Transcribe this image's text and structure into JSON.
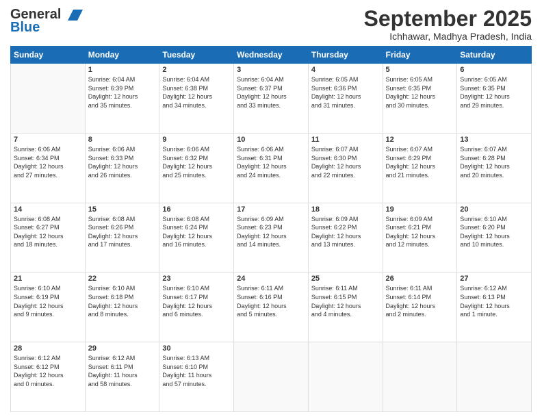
{
  "logo": {
    "line1": "General",
    "line2": "Blue"
  },
  "title": "September 2025",
  "subtitle": "Ichhawar, Madhya Pradesh, India",
  "days_of_week": [
    "Sunday",
    "Monday",
    "Tuesday",
    "Wednesday",
    "Thursday",
    "Friday",
    "Saturday"
  ],
  "weeks": [
    [
      {
        "day": "",
        "info": ""
      },
      {
        "day": "1",
        "info": "Sunrise: 6:04 AM\nSunset: 6:39 PM\nDaylight: 12 hours\nand 35 minutes."
      },
      {
        "day": "2",
        "info": "Sunrise: 6:04 AM\nSunset: 6:38 PM\nDaylight: 12 hours\nand 34 minutes."
      },
      {
        "day": "3",
        "info": "Sunrise: 6:04 AM\nSunset: 6:37 PM\nDaylight: 12 hours\nand 33 minutes."
      },
      {
        "day": "4",
        "info": "Sunrise: 6:05 AM\nSunset: 6:36 PM\nDaylight: 12 hours\nand 31 minutes."
      },
      {
        "day": "5",
        "info": "Sunrise: 6:05 AM\nSunset: 6:35 PM\nDaylight: 12 hours\nand 30 minutes."
      },
      {
        "day": "6",
        "info": "Sunrise: 6:05 AM\nSunset: 6:35 PM\nDaylight: 12 hours\nand 29 minutes."
      }
    ],
    [
      {
        "day": "7",
        "info": "Sunrise: 6:06 AM\nSunset: 6:34 PM\nDaylight: 12 hours\nand 27 minutes."
      },
      {
        "day": "8",
        "info": "Sunrise: 6:06 AM\nSunset: 6:33 PM\nDaylight: 12 hours\nand 26 minutes."
      },
      {
        "day": "9",
        "info": "Sunrise: 6:06 AM\nSunset: 6:32 PM\nDaylight: 12 hours\nand 25 minutes."
      },
      {
        "day": "10",
        "info": "Sunrise: 6:06 AM\nSunset: 6:31 PM\nDaylight: 12 hours\nand 24 minutes."
      },
      {
        "day": "11",
        "info": "Sunrise: 6:07 AM\nSunset: 6:30 PM\nDaylight: 12 hours\nand 22 minutes."
      },
      {
        "day": "12",
        "info": "Sunrise: 6:07 AM\nSunset: 6:29 PM\nDaylight: 12 hours\nand 21 minutes."
      },
      {
        "day": "13",
        "info": "Sunrise: 6:07 AM\nSunset: 6:28 PM\nDaylight: 12 hours\nand 20 minutes."
      }
    ],
    [
      {
        "day": "14",
        "info": "Sunrise: 6:08 AM\nSunset: 6:27 PM\nDaylight: 12 hours\nand 18 minutes."
      },
      {
        "day": "15",
        "info": "Sunrise: 6:08 AM\nSunset: 6:26 PM\nDaylight: 12 hours\nand 17 minutes."
      },
      {
        "day": "16",
        "info": "Sunrise: 6:08 AM\nSunset: 6:24 PM\nDaylight: 12 hours\nand 16 minutes."
      },
      {
        "day": "17",
        "info": "Sunrise: 6:09 AM\nSunset: 6:23 PM\nDaylight: 12 hours\nand 14 minutes."
      },
      {
        "day": "18",
        "info": "Sunrise: 6:09 AM\nSunset: 6:22 PM\nDaylight: 12 hours\nand 13 minutes."
      },
      {
        "day": "19",
        "info": "Sunrise: 6:09 AM\nSunset: 6:21 PM\nDaylight: 12 hours\nand 12 minutes."
      },
      {
        "day": "20",
        "info": "Sunrise: 6:10 AM\nSunset: 6:20 PM\nDaylight: 12 hours\nand 10 minutes."
      }
    ],
    [
      {
        "day": "21",
        "info": "Sunrise: 6:10 AM\nSunset: 6:19 PM\nDaylight: 12 hours\nand 9 minutes."
      },
      {
        "day": "22",
        "info": "Sunrise: 6:10 AM\nSunset: 6:18 PM\nDaylight: 12 hours\nand 8 minutes."
      },
      {
        "day": "23",
        "info": "Sunrise: 6:10 AM\nSunset: 6:17 PM\nDaylight: 12 hours\nand 6 minutes."
      },
      {
        "day": "24",
        "info": "Sunrise: 6:11 AM\nSunset: 6:16 PM\nDaylight: 12 hours\nand 5 minutes."
      },
      {
        "day": "25",
        "info": "Sunrise: 6:11 AM\nSunset: 6:15 PM\nDaylight: 12 hours\nand 4 minutes."
      },
      {
        "day": "26",
        "info": "Sunrise: 6:11 AM\nSunset: 6:14 PM\nDaylight: 12 hours\nand 2 minutes."
      },
      {
        "day": "27",
        "info": "Sunrise: 6:12 AM\nSunset: 6:13 PM\nDaylight: 12 hours\nand 1 minute."
      }
    ],
    [
      {
        "day": "28",
        "info": "Sunrise: 6:12 AM\nSunset: 6:12 PM\nDaylight: 12 hours\nand 0 minutes."
      },
      {
        "day": "29",
        "info": "Sunrise: 6:12 AM\nSunset: 6:11 PM\nDaylight: 11 hours\nand 58 minutes."
      },
      {
        "day": "30",
        "info": "Sunrise: 6:13 AM\nSunset: 6:10 PM\nDaylight: 11 hours\nand 57 minutes."
      },
      {
        "day": "",
        "info": ""
      },
      {
        "day": "",
        "info": ""
      },
      {
        "day": "",
        "info": ""
      },
      {
        "day": "",
        "info": ""
      }
    ]
  ]
}
